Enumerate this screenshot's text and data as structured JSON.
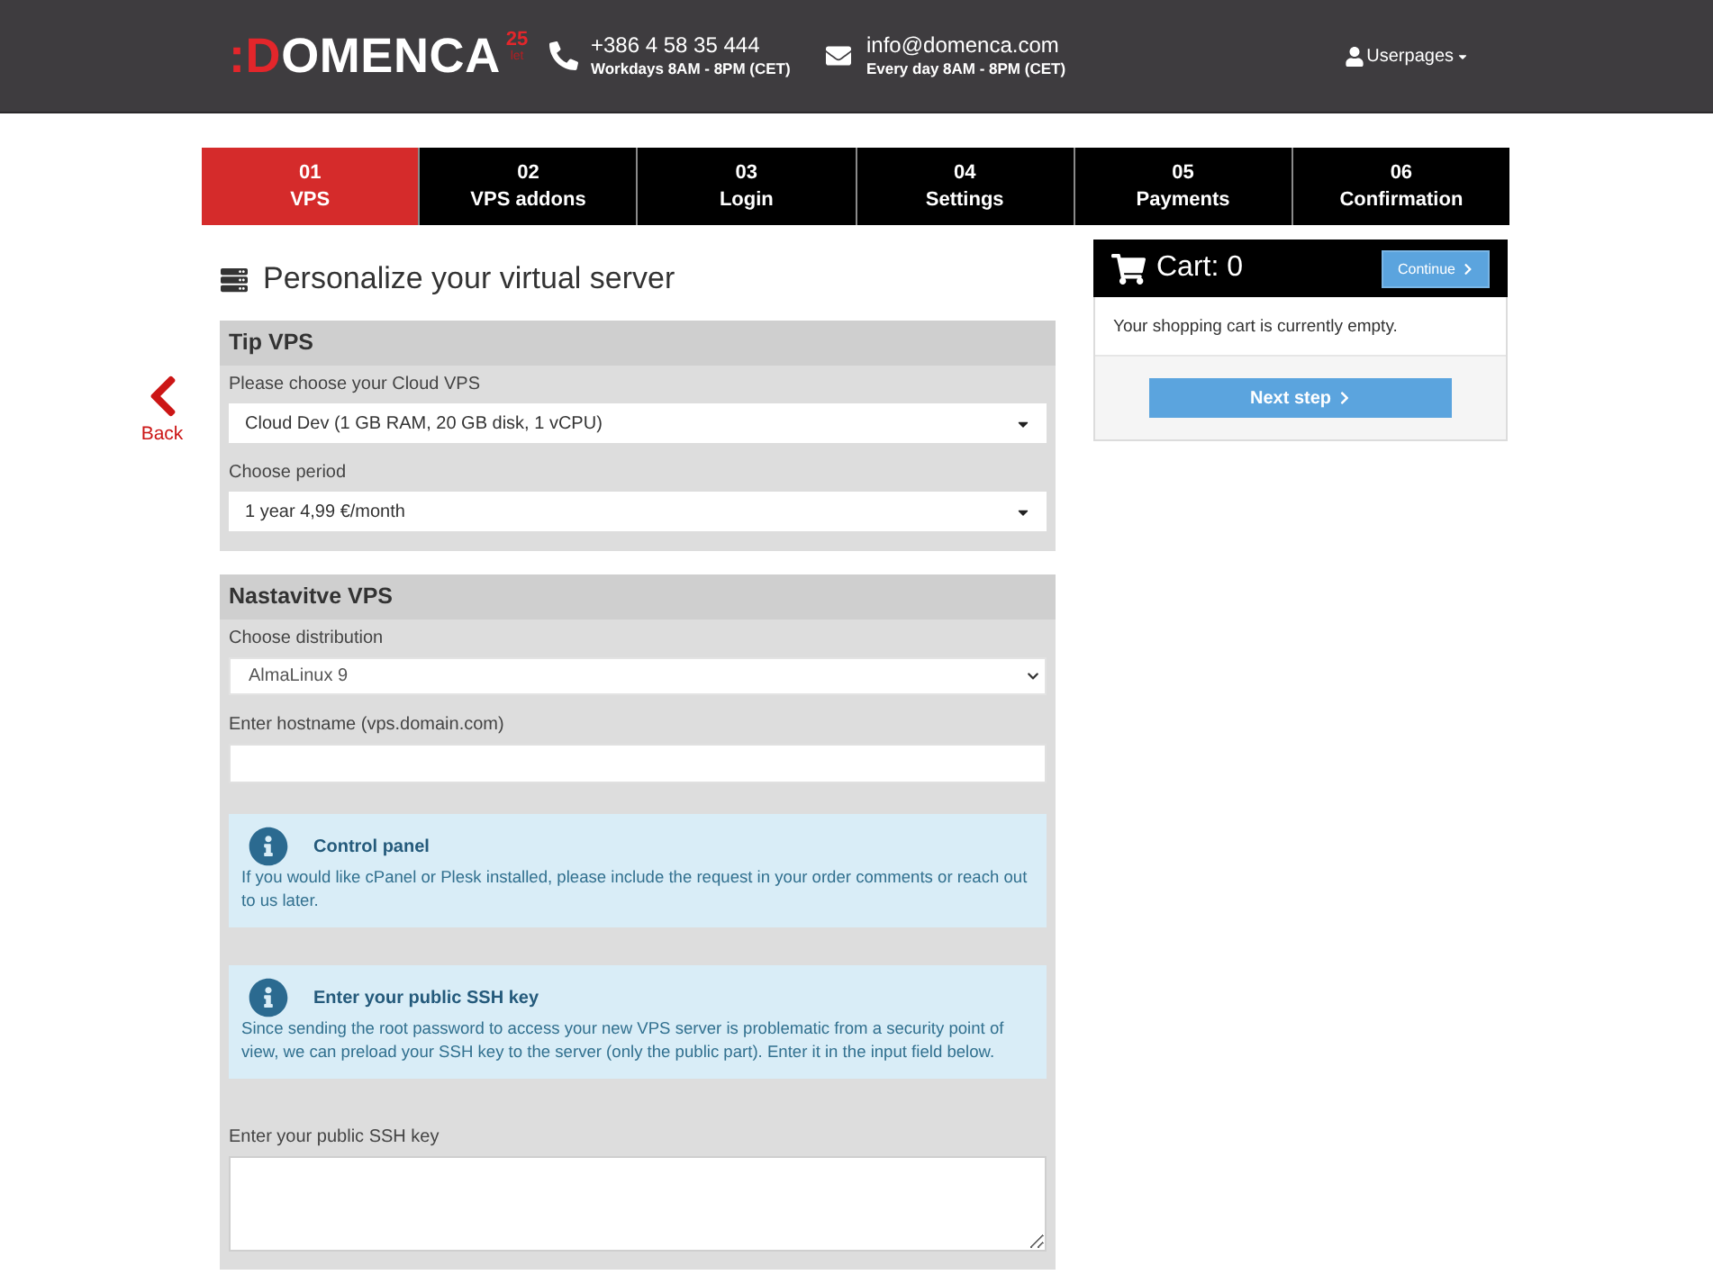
{
  "header": {
    "logo": {
      "accent": ":D",
      "name": "OMENCA",
      "badge_number": "25",
      "badge_text": "let"
    },
    "contacts": [
      {
        "kind": "phone",
        "value": "+386 4 58 35 444",
        "hours": "Workdays 8AM - 8PM (CET)"
      },
      {
        "kind": "email",
        "value": "info@domenca.com",
        "hours": "Every day 8AM - 8PM (CET)"
      }
    ],
    "user_menu": {
      "label": "Userpages"
    }
  },
  "steps": [
    {
      "number": "01",
      "label": "VPS",
      "selected": true
    },
    {
      "number": "02",
      "label": "VPS addons",
      "selected": false
    },
    {
      "number": "03",
      "label": "Login",
      "selected": false
    },
    {
      "number": "04",
      "label": "Settings",
      "selected": false
    },
    {
      "number": "05",
      "label": "Payments",
      "selected": false
    },
    {
      "number": "06",
      "label": "Confirmation",
      "selected": false
    }
  ],
  "back": {
    "label": "Back"
  },
  "page_title": "Personalize your virtual server",
  "sections": [
    {
      "title": "Tip VPS",
      "fields": [
        {
          "kind": "dropdown",
          "label": "Please choose your Cloud VPS",
          "value": "Cloud Dev (1 GB RAM, 20 GB disk, 1 vCPU)"
        },
        {
          "kind": "dropdown",
          "label": "Choose period",
          "value": "1 year 4,99 €/month"
        }
      ]
    },
    {
      "title": "Nastavitve VPS",
      "fields": [
        {
          "kind": "select",
          "label": "Choose distribution",
          "value": "AlmaLinux 9"
        },
        {
          "kind": "text",
          "label": "Enter hostname (vps.domain.com)"
        },
        {
          "kind": "info",
          "title": "Control panel",
          "text": "If you would like cPanel or Plesk installed, please include the request in your order comments or reach out to us later."
        },
        {
          "kind": "info",
          "title": "Enter your public SSH key",
          "text": "Since sending the root password to access your new VPS server is problematic from a security point of view, we can preload your SSH key to the server (only the public part). Enter it in the input field below."
        },
        {
          "kind": "textarea",
          "label": "Enter your public SSH key"
        }
      ]
    }
  ],
  "cart": {
    "title": "Cart: 0",
    "continue_label": "Continue",
    "message": "Your shopping cart is currently empty.",
    "next_label": "Next step"
  }
}
